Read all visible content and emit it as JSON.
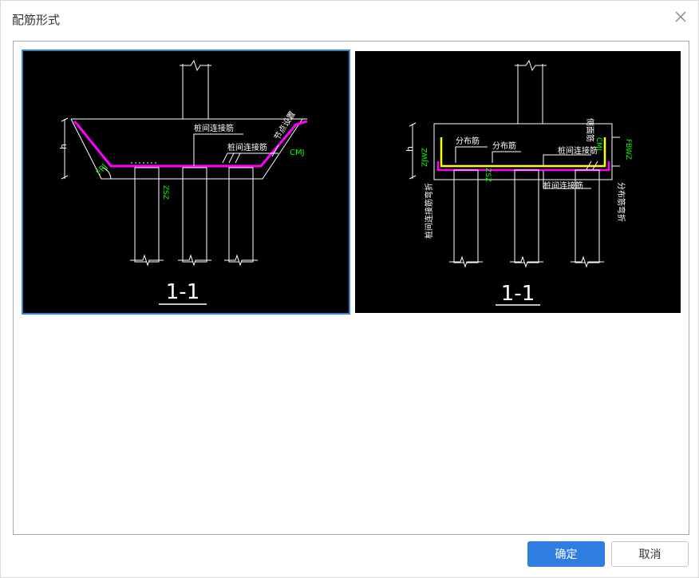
{
  "dialog": {
    "title": "配筋形式",
    "ok_label": "确定",
    "cancel_label": "取消"
  },
  "options": [
    {
      "section_label": "1-1",
      "labels": {
        "between_pile": "桩间连接筋",
        "between_pile_2": "桩间连接筋",
        "slope": "节点设置",
        "h": "h",
        "fp": "FPJ",
        "cm": "CMJ",
        "zs": "ZSZ"
      },
      "selected": true
    },
    {
      "section_label": "1-1",
      "labels": {
        "dist1": "分布筋",
        "dist2": "分布筋",
        "between_pile": "桩间连接筋",
        "between_pile_bottom": "桩间连接筋",
        "side": "侧面筋",
        "h": "h",
        "zjwz": "ZJWZ",
        "pile_bend": "桩间连接筋弯折",
        "cmj": "CMJ",
        "fbwz": "FBWZ",
        "dist_bend": "分布筋弯折",
        "zs": "ZSZ"
      },
      "selected": false
    }
  ]
}
